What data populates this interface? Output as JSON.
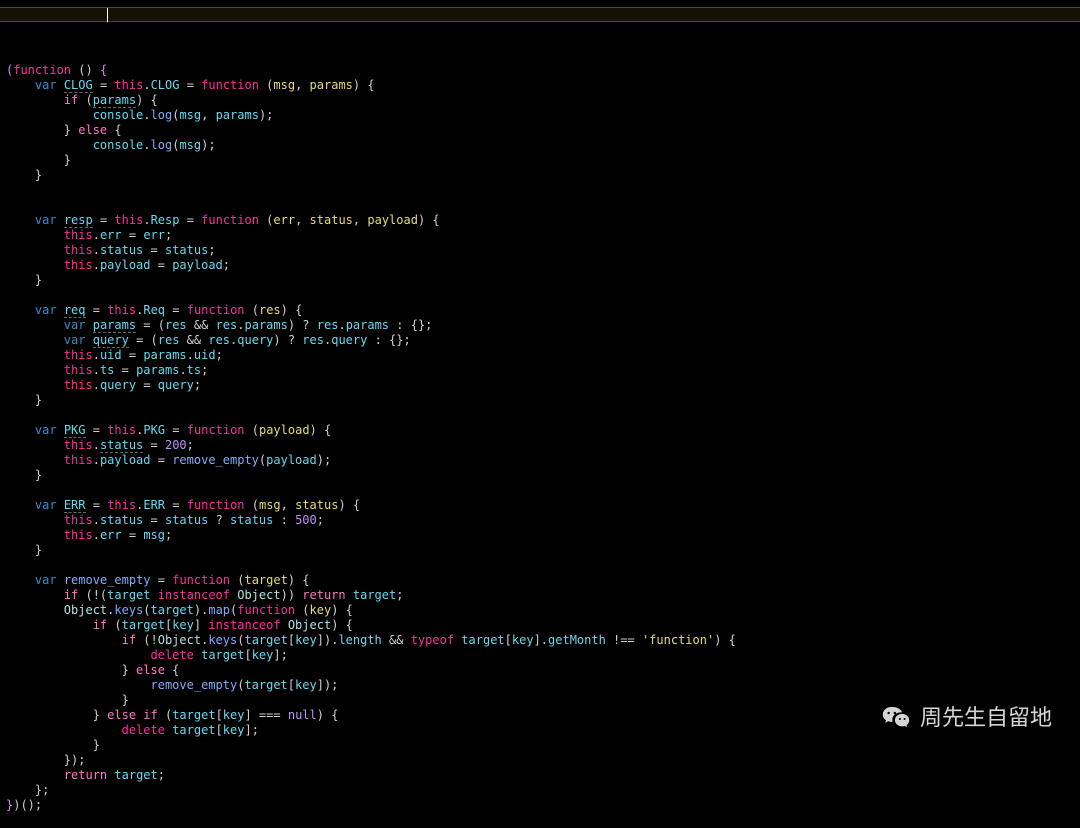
{
  "editor": {
    "highlight_line_index": 0,
    "cursor_col_approx": 14,
    "code_tokens": [
      [
        [
          "pur",
          "("
        ],
        [
          "mag",
          "function"
        ],
        [
          "op",
          " () "
        ],
        [
          "pur",
          "{"
        ]
      ],
      [
        [
          "op",
          "    "
        ],
        [
          "blue",
          "var"
        ],
        [
          "op",
          " "
        ],
        [
          "cyan",
          "CLOG"
        ],
        [
          "op",
          " = "
        ],
        [
          "mag",
          "this"
        ],
        [
          "op",
          "."
        ],
        [
          "cyan",
          "CLOG"
        ],
        [
          "op",
          " = "
        ],
        [
          "mag",
          "function"
        ],
        [
          "op",
          " ("
        ],
        [
          "yel",
          "msg"
        ],
        [
          "op",
          ", "
        ],
        [
          "yel",
          "params"
        ],
        [
          "op",
          ") {"
        ]
      ],
      [
        [
          "op",
          "        "
        ],
        [
          "pink",
          "if"
        ],
        [
          "op",
          " ("
        ],
        [
          "cyan",
          "params"
        ],
        [
          "op",
          ") {"
        ]
      ],
      [
        [
          "op",
          "            "
        ],
        [
          "cyan",
          "console"
        ],
        [
          "op",
          "."
        ],
        [
          "fun",
          "log"
        ],
        [
          "op",
          "("
        ],
        [
          "cyan",
          "msg"
        ],
        [
          "op",
          ", "
        ],
        [
          "cyan",
          "params"
        ],
        [
          "op",
          ");"
        ]
      ],
      [
        [
          "op",
          "        } "
        ],
        [
          "pink",
          "else"
        ],
        [
          "op",
          " {"
        ]
      ],
      [
        [
          "op",
          "            "
        ],
        [
          "cyan",
          "console"
        ],
        [
          "op",
          "."
        ],
        [
          "fun",
          "log"
        ],
        [
          "op",
          "("
        ],
        [
          "cyan",
          "msg"
        ],
        [
          "op",
          ");"
        ]
      ],
      [
        [
          "op",
          "        }"
        ]
      ],
      [
        [
          "op",
          "    }"
        ]
      ],
      [
        [
          "op",
          ""
        ]
      ],
      [
        [
          "op",
          ""
        ]
      ],
      [
        [
          "op",
          "    "
        ],
        [
          "blue",
          "var"
        ],
        [
          "op",
          " "
        ],
        [
          "cyan",
          "resp"
        ],
        [
          "op",
          " = "
        ],
        [
          "mag",
          "this"
        ],
        [
          "op",
          "."
        ],
        [
          "cyan",
          "Resp"
        ],
        [
          "op",
          " = "
        ],
        [
          "mag",
          "function"
        ],
        [
          "op",
          " ("
        ],
        [
          "yel",
          "err"
        ],
        [
          "op",
          ", "
        ],
        [
          "yel",
          "status"
        ],
        [
          "op",
          ", "
        ],
        [
          "yel",
          "payload"
        ],
        [
          "op",
          ") {"
        ]
      ],
      [
        [
          "op",
          "        "
        ],
        [
          "mag",
          "this"
        ],
        [
          "op",
          "."
        ],
        [
          "cyan",
          "err"
        ],
        [
          "op",
          " = "
        ],
        [
          "cyan",
          "err"
        ],
        [
          "op",
          ";"
        ]
      ],
      [
        [
          "op",
          "        "
        ],
        [
          "mag",
          "this"
        ],
        [
          "op",
          "."
        ],
        [
          "cyan",
          "status"
        ],
        [
          "op",
          " = "
        ],
        [
          "cyan",
          "status"
        ],
        [
          "op",
          ";"
        ]
      ],
      [
        [
          "op",
          "        "
        ],
        [
          "mag",
          "this"
        ],
        [
          "op",
          "."
        ],
        [
          "cyan",
          "payload"
        ],
        [
          "op",
          " = "
        ],
        [
          "cyan",
          "payload"
        ],
        [
          "op",
          ";"
        ]
      ],
      [
        [
          "op",
          "    }"
        ]
      ],
      [
        [
          "op",
          ""
        ]
      ],
      [
        [
          "op",
          "    "
        ],
        [
          "blue",
          "var"
        ],
        [
          "op",
          " "
        ],
        [
          "cyan",
          "req"
        ],
        [
          "op",
          " = "
        ],
        [
          "mag",
          "this"
        ],
        [
          "op",
          "."
        ],
        [
          "cyan",
          "Req"
        ],
        [
          "op",
          " = "
        ],
        [
          "mag",
          "function"
        ],
        [
          "op",
          " ("
        ],
        [
          "yel",
          "res"
        ],
        [
          "op",
          ") {"
        ]
      ],
      [
        [
          "op",
          "        "
        ],
        [
          "blue",
          "var"
        ],
        [
          "op",
          " "
        ],
        [
          "cyan",
          "params"
        ],
        [
          "op",
          " = ("
        ],
        [
          "cyan",
          "res"
        ],
        [
          "op",
          " && "
        ],
        [
          "cyan",
          "res"
        ],
        [
          "op",
          "."
        ],
        [
          "cyan",
          "params"
        ],
        [
          "op",
          ") ? "
        ],
        [
          "cyan",
          "res"
        ],
        [
          "op",
          "."
        ],
        [
          "cyan",
          "params"
        ],
        [
          "op",
          " : {};"
        ]
      ],
      [
        [
          "op",
          "        "
        ],
        [
          "blue",
          "var"
        ],
        [
          "op",
          " "
        ],
        [
          "cyan",
          "query"
        ],
        [
          "op",
          " = ("
        ],
        [
          "cyan",
          "res"
        ],
        [
          "op",
          " && "
        ],
        [
          "cyan",
          "res"
        ],
        [
          "op",
          "."
        ],
        [
          "cyan",
          "query"
        ],
        [
          "op",
          ") ? "
        ],
        [
          "cyan",
          "res"
        ],
        [
          "op",
          "."
        ],
        [
          "cyan",
          "query"
        ],
        [
          "op",
          " : {};"
        ]
      ],
      [
        [
          "op",
          "        "
        ],
        [
          "mag",
          "this"
        ],
        [
          "op",
          "."
        ],
        [
          "cyan",
          "uid"
        ],
        [
          "op",
          " = "
        ],
        [
          "cyan",
          "params"
        ],
        [
          "op",
          "."
        ],
        [
          "cyan",
          "uid"
        ],
        [
          "op",
          ";"
        ]
      ],
      [
        [
          "op",
          "        "
        ],
        [
          "mag",
          "this"
        ],
        [
          "op",
          "."
        ],
        [
          "cyan",
          "ts"
        ],
        [
          "op",
          " = "
        ],
        [
          "cyan",
          "params"
        ],
        [
          "op",
          "."
        ],
        [
          "cyan",
          "ts"
        ],
        [
          "op",
          ";"
        ]
      ],
      [
        [
          "op",
          "        "
        ],
        [
          "mag",
          "this"
        ],
        [
          "op",
          "."
        ],
        [
          "cyan",
          "query"
        ],
        [
          "op",
          " = "
        ],
        [
          "cyan",
          "query"
        ],
        [
          "op",
          ";"
        ]
      ],
      [
        [
          "op",
          "    }"
        ]
      ],
      [
        [
          "op",
          ""
        ]
      ],
      [
        [
          "op",
          "    "
        ],
        [
          "blue",
          "var"
        ],
        [
          "op",
          " "
        ],
        [
          "cyan",
          "PKG"
        ],
        [
          "op",
          " = "
        ],
        [
          "mag",
          "this"
        ],
        [
          "op",
          "."
        ],
        [
          "cyan",
          "PKG"
        ],
        [
          "op",
          " = "
        ],
        [
          "mag",
          "function"
        ],
        [
          "op",
          " ("
        ],
        [
          "yel",
          "payload"
        ],
        [
          "op",
          ") {"
        ]
      ],
      [
        [
          "op",
          "        "
        ],
        [
          "mag",
          "this"
        ],
        [
          "op",
          "."
        ],
        [
          "cyan",
          "status"
        ],
        [
          "op",
          " = "
        ],
        [
          "num",
          "200"
        ],
        [
          "op",
          ";"
        ]
      ],
      [
        [
          "op",
          "        "
        ],
        [
          "mag",
          "this"
        ],
        [
          "op",
          "."
        ],
        [
          "cyan",
          "payload"
        ],
        [
          "op",
          " = "
        ],
        [
          "fun",
          "remove_empty"
        ],
        [
          "op",
          "("
        ],
        [
          "cyan",
          "payload"
        ],
        [
          "op",
          ");"
        ]
      ],
      [
        [
          "op",
          "    }"
        ]
      ],
      [
        [
          "op",
          ""
        ]
      ],
      [
        [
          "op",
          "    "
        ],
        [
          "blue",
          "var"
        ],
        [
          "op",
          " "
        ],
        [
          "cyan",
          "ERR"
        ],
        [
          "op",
          " = "
        ],
        [
          "mag",
          "this"
        ],
        [
          "op",
          "."
        ],
        [
          "cyan",
          "ERR"
        ],
        [
          "op",
          " = "
        ],
        [
          "mag",
          "function"
        ],
        [
          "op",
          " ("
        ],
        [
          "yel",
          "msg"
        ],
        [
          "op",
          ", "
        ],
        [
          "yel",
          "status"
        ],
        [
          "op",
          ") {"
        ]
      ],
      [
        [
          "op",
          "        "
        ],
        [
          "mag",
          "this"
        ],
        [
          "op",
          "."
        ],
        [
          "cyan",
          "status"
        ],
        [
          "op",
          " = "
        ],
        [
          "cyan",
          "status"
        ],
        [
          "op",
          " ? "
        ],
        [
          "cyan",
          "status"
        ],
        [
          "op",
          " : "
        ],
        [
          "num",
          "500"
        ],
        [
          "op",
          ";"
        ]
      ],
      [
        [
          "op",
          "        "
        ],
        [
          "mag",
          "this"
        ],
        [
          "op",
          "."
        ],
        [
          "cyan",
          "err"
        ],
        [
          "op",
          " = "
        ],
        [
          "cyan",
          "msg"
        ],
        [
          "op",
          ";"
        ]
      ],
      [
        [
          "op",
          "    }"
        ]
      ],
      [
        [
          "op",
          ""
        ]
      ],
      [
        [
          "op",
          "    "
        ],
        [
          "blue",
          "var"
        ],
        [
          "op",
          " "
        ],
        [
          "fun",
          "remove_empty"
        ],
        [
          "op",
          " = "
        ],
        [
          "mag",
          "function"
        ],
        [
          "op",
          " ("
        ],
        [
          "yel",
          "target"
        ],
        [
          "op",
          ") {"
        ]
      ],
      [
        [
          "op",
          "        "
        ],
        [
          "pink",
          "if"
        ],
        [
          "op",
          " (!("
        ],
        [
          "cyan",
          "target"
        ],
        [
          "op",
          " "
        ],
        [
          "mag",
          "instanceof"
        ],
        [
          "op",
          " "
        ],
        [
          "key",
          "Object"
        ],
        [
          "op",
          ")) "
        ],
        [
          "pink",
          "return"
        ],
        [
          "op",
          " "
        ],
        [
          "cyan",
          "target"
        ],
        [
          "op",
          ";"
        ]
      ],
      [
        [
          "op",
          "        "
        ],
        [
          "key",
          "Object"
        ],
        [
          "op",
          "."
        ],
        [
          "fun",
          "keys"
        ],
        [
          "op",
          "("
        ],
        [
          "cyan",
          "target"
        ],
        [
          "op",
          ")."
        ],
        [
          "fun",
          "map"
        ],
        [
          "op",
          "("
        ],
        [
          "mag",
          "function"
        ],
        [
          "op",
          " ("
        ],
        [
          "yel",
          "key"
        ],
        [
          "op",
          ") {"
        ]
      ],
      [
        [
          "op",
          "            "
        ],
        [
          "pink",
          "if"
        ],
        [
          "op",
          " ("
        ],
        [
          "cyan",
          "target"
        ],
        [
          "op",
          "["
        ],
        [
          "cyan",
          "key"
        ],
        [
          "op",
          "] "
        ],
        [
          "mag",
          "instanceof"
        ],
        [
          "op",
          " "
        ],
        [
          "key",
          "Object"
        ],
        [
          "op",
          ") {"
        ]
      ],
      [
        [
          "op",
          "                "
        ],
        [
          "pink",
          "if"
        ],
        [
          "op",
          " (!"
        ],
        [
          "key",
          "Object"
        ],
        [
          "op",
          "."
        ],
        [
          "fun",
          "keys"
        ],
        [
          "op",
          "("
        ],
        [
          "cyan",
          "target"
        ],
        [
          "op",
          "["
        ],
        [
          "cyan",
          "key"
        ],
        [
          "op",
          "])."
        ],
        [
          "cyan",
          "length"
        ],
        [
          "op",
          " && "
        ],
        [
          "mag",
          "typeof"
        ],
        [
          "op",
          " "
        ],
        [
          "cyan",
          "target"
        ],
        [
          "op",
          "["
        ],
        [
          "cyan",
          "key"
        ],
        [
          "op",
          "]."
        ],
        [
          "cyan",
          "getMonth"
        ],
        [
          "op",
          " !== "
        ],
        [
          "str",
          "'function'"
        ],
        [
          "op",
          ") {"
        ]
      ],
      [
        [
          "op",
          "                    "
        ],
        [
          "mag",
          "delete"
        ],
        [
          "op",
          " "
        ],
        [
          "cyan",
          "target"
        ],
        [
          "op",
          "["
        ],
        [
          "cyan",
          "key"
        ],
        [
          "op",
          "];"
        ]
      ],
      [
        [
          "op",
          "                } "
        ],
        [
          "pink",
          "else"
        ],
        [
          "op",
          " {"
        ]
      ],
      [
        [
          "op",
          "                    "
        ],
        [
          "fun",
          "remove_empty"
        ],
        [
          "op",
          "("
        ],
        [
          "cyan",
          "target"
        ],
        [
          "op",
          "["
        ],
        [
          "cyan",
          "key"
        ],
        [
          "op",
          "]);"
        ]
      ],
      [
        [
          "op",
          "                }"
        ]
      ],
      [
        [
          "op",
          "            } "
        ],
        [
          "pink",
          "else"
        ],
        [
          "op",
          " "
        ],
        [
          "pink",
          "if"
        ],
        [
          "op",
          " ("
        ],
        [
          "cyan",
          "target"
        ],
        [
          "op",
          "["
        ],
        [
          "cyan",
          "key"
        ],
        [
          "op",
          "] === "
        ],
        [
          "num",
          "null"
        ],
        [
          "op",
          ") {"
        ]
      ],
      [
        [
          "op",
          "                "
        ],
        [
          "mag",
          "delete"
        ],
        [
          "op",
          " "
        ],
        [
          "cyan",
          "target"
        ],
        [
          "op",
          "["
        ],
        [
          "cyan",
          "key"
        ],
        [
          "op",
          "];"
        ]
      ],
      [
        [
          "op",
          "            }"
        ]
      ],
      [
        [
          "op",
          "        });"
        ]
      ],
      [
        [
          "op",
          "        "
        ],
        [
          "pink",
          "return"
        ],
        [
          "op",
          " "
        ],
        [
          "cyan",
          "target"
        ],
        [
          "op",
          ";"
        ]
      ],
      [
        [
          "op",
          "    };"
        ]
      ],
      [
        [
          "pur",
          "}"
        ],
        [
          "op",
          ")();"
        ]
      ]
    ]
  },
  "watermark": {
    "text": "周先生自留地",
    "icon": "wechat-icon"
  }
}
